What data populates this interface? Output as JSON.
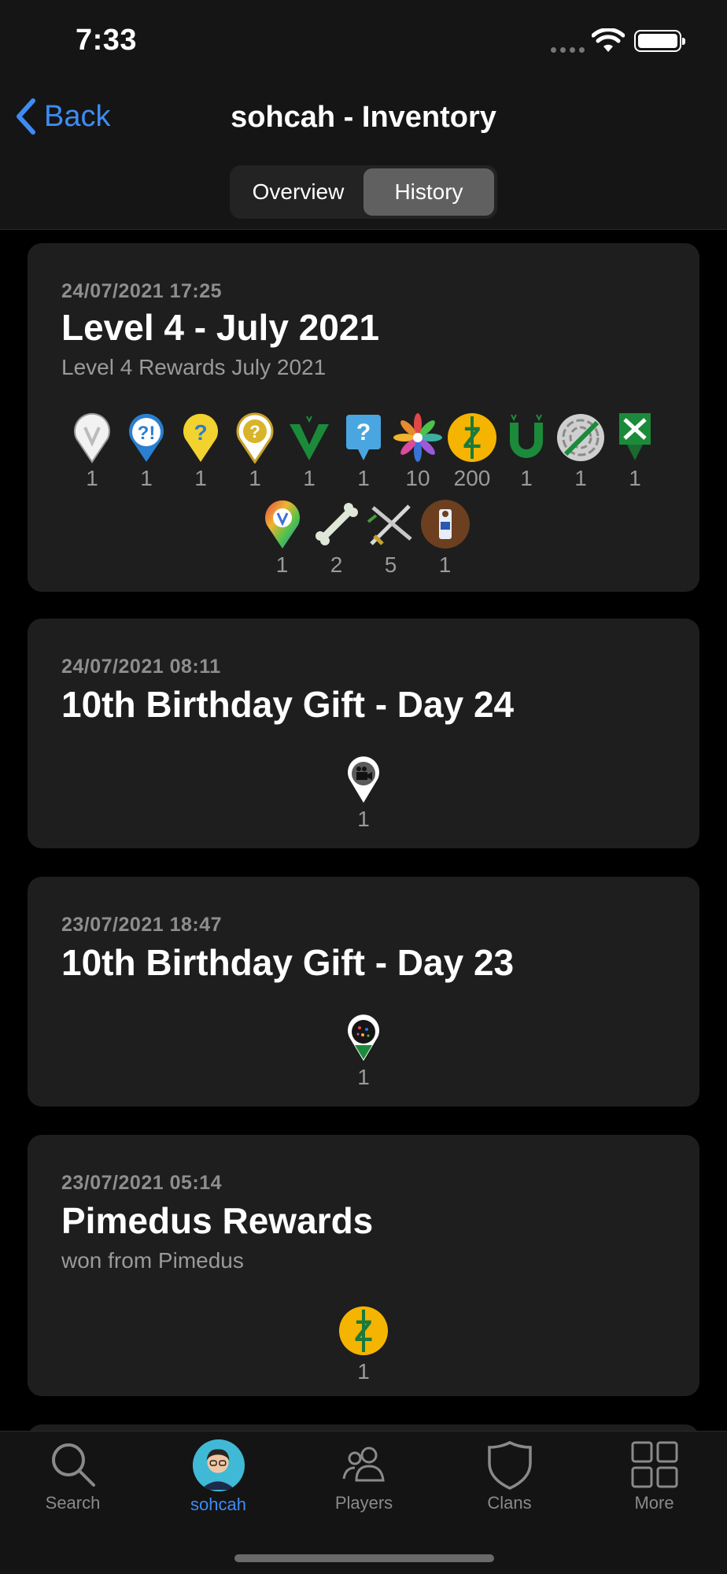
{
  "status": {
    "time": "7:33"
  },
  "nav": {
    "back_label": "Back",
    "title": "sohcah - Inventory"
  },
  "segments": [
    {
      "label": "Overview",
      "active": false
    },
    {
      "label": "History",
      "active": true
    }
  ],
  "cards": [
    {
      "date": "24/07/2021 17:25",
      "title": "Level 4 - July 2021",
      "subtitle": "Level 4 Rewards July 2021",
      "items": [
        {
          "icon": "white-virtual-pin-icon",
          "qty": "1"
        },
        {
          "icon": "mystery-blue-pin-icon",
          "qty": "1"
        },
        {
          "icon": "yellow-mystery-pin-icon",
          "qty": "1"
        },
        {
          "icon": "gold-mystery-pin-icon",
          "qty": "1"
        },
        {
          "icon": "green-v-pin-icon",
          "qty": "1"
        },
        {
          "icon": "blue-mystery-sign-icon",
          "qty": "1"
        },
        {
          "icon": "rainbow-flower-icon",
          "qty": "10"
        },
        {
          "icon": "zeecred-coin-icon",
          "qty": "200"
        },
        {
          "icon": "green-magnet-icon",
          "qty": "1"
        },
        {
          "icon": "maze-icon",
          "qty": "1"
        },
        {
          "icon": "green-trail-sign-icon",
          "qty": "1"
        },
        {
          "icon": "rainbow-virtual-pin-icon",
          "qty": "1"
        },
        {
          "icon": "bone-icon",
          "qty": "2"
        },
        {
          "icon": "crossed-swords-icon",
          "qty": "5"
        },
        {
          "icon": "do-not-disturb-door-icon",
          "qty": "1"
        }
      ]
    },
    {
      "date": "24/07/2021 08:11",
      "title": "10th Birthday Gift - Day 24",
      "subtitle": "",
      "items": [
        {
          "icon": "film-camera-pin-icon",
          "qty": "1"
        }
      ]
    },
    {
      "date": "23/07/2021 18:47",
      "title": "10th Birthday Gift - Day 23",
      "subtitle": "",
      "items": [
        {
          "icon": "fireworks-pin-icon",
          "qty": "1"
        }
      ]
    },
    {
      "date": "23/07/2021 05:14",
      "title": "Pimedus Rewards",
      "subtitle": "won from Pimedus",
      "items": [
        {
          "icon": "zeecred-coin-icon",
          "qty": "1"
        }
      ]
    }
  ],
  "tabs": [
    {
      "label": "Search",
      "icon": "search-icon",
      "active": false
    },
    {
      "label": "sohcah",
      "icon": "avatar",
      "active": true
    },
    {
      "label": "Players",
      "icon": "players-icon",
      "active": false
    },
    {
      "label": "Clans",
      "icon": "shield-icon",
      "active": false
    },
    {
      "label": "More",
      "icon": "grid-icon",
      "active": false
    }
  ],
  "colors": {
    "accent": "#3e8cf3",
    "card": "#1e1e1e",
    "background": "#000000"
  }
}
